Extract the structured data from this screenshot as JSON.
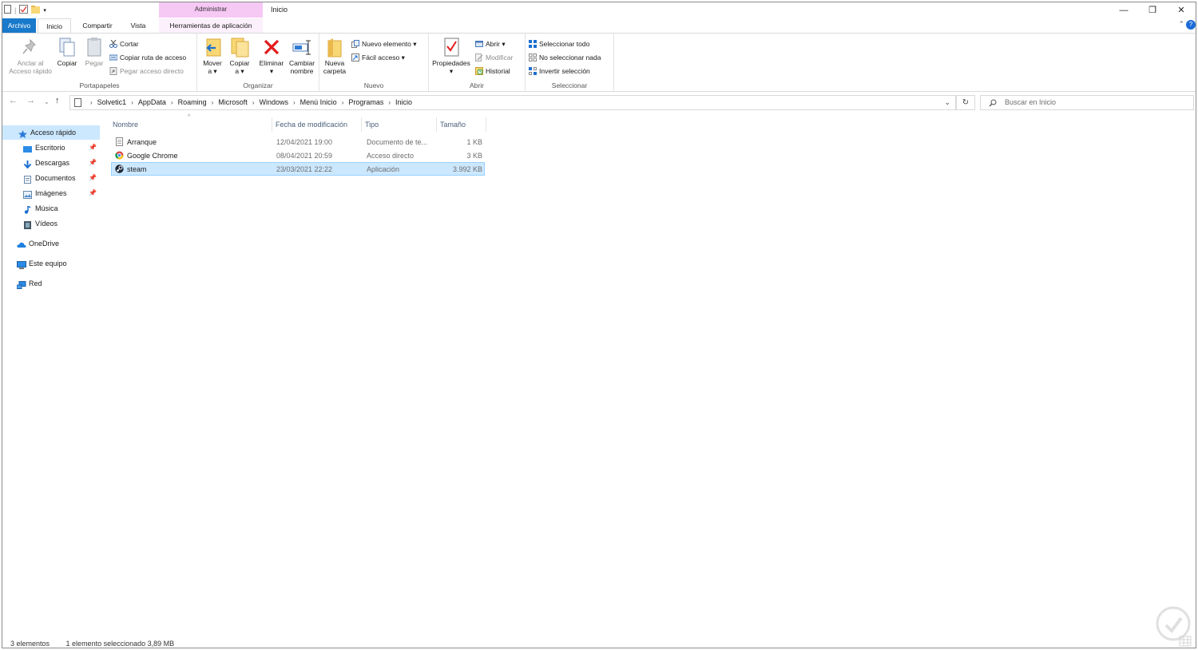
{
  "window": {
    "title": "Inicio",
    "context_group": "Administrar",
    "controls": [
      "—",
      "❐",
      "✕"
    ]
  },
  "tabs": {
    "file": "Archivo",
    "home": "Inicio",
    "share": "Compartir",
    "view": "Vista",
    "app_tools": "Herramientas de aplicación"
  },
  "ribbon": {
    "clipboard": {
      "group_label": "Portapapeles",
      "pin_label_1": "Anclar al",
      "pin_label_2": "Acceso rápido",
      "copy": "Copiar",
      "paste": "Pegar",
      "cut": "Cortar",
      "copy_path": "Copiar ruta de acceso",
      "paste_shortcut": "Pegar acceso directo"
    },
    "organize": {
      "group_label": "Organizar",
      "move_1": "Mover",
      "move_2": "a",
      "copy_1": "Copiar",
      "copy_2": "a",
      "delete": "Eliminar",
      "rename_1": "Cambiar",
      "rename_2": "nombre"
    },
    "new": {
      "group_label": "Nuevo",
      "new_folder_1": "Nueva",
      "new_folder_2": "carpeta",
      "new_item": "Nuevo elemento",
      "easy_access": "Fácil acceso"
    },
    "open": {
      "group_label": "Abrir",
      "properties": "Propiedades",
      "open": "Abrir",
      "edit": "Modificar",
      "history": "Historial"
    },
    "select": {
      "group_label": "Seleccionar",
      "select_all": "Seleccionar todo",
      "select_none": "No seleccionar nada",
      "invert": "Invertir selección"
    }
  },
  "address": {
    "crumbs": [
      "Solvetic1",
      "AppData",
      "Roaming",
      "Microsoft",
      "Windows",
      "Menú Inicio",
      "Programas",
      "Inicio"
    ],
    "search_placeholder": "Buscar en Inicio"
  },
  "nav": {
    "quick_access": "Acceso rápido",
    "items": [
      "Escritorio",
      "Descargas",
      "Documentos",
      "Imágenes",
      "Música",
      "Vídeos"
    ],
    "onedrive": "OneDrive",
    "this_pc": "Este equipo",
    "network": "Red"
  },
  "columns": {
    "name": "Nombre",
    "modified": "Fecha de modificación",
    "type": "Tipo",
    "size": "Tamaño"
  },
  "files": [
    {
      "name": "Arranque",
      "modified": "12/04/2021 19:00",
      "type": "Documento de te...",
      "size": "1 KB"
    },
    {
      "name": "Google Chrome",
      "modified": "08/04/2021 20:59",
      "type": "Acceso directo",
      "size": "3 KB"
    },
    {
      "name": "steam",
      "modified": "23/03/2021 22:22",
      "type": "Aplicación",
      "size": "3.992 KB"
    }
  ],
  "status": {
    "count": "3 elementos",
    "selection": "1 elemento seleccionado  3,89 MB"
  },
  "colors": {
    "accent": "#1979ca",
    "selection": "#cce8ff",
    "context_tab": "#f6c8f4"
  }
}
